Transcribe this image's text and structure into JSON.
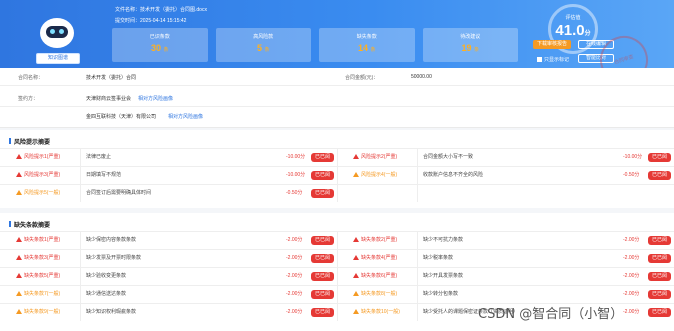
{
  "header": {
    "file_label": "文件名称：技术开发（委托）合同图.docx",
    "time_label": "提交时间：2025-04-14 15:15:42",
    "kb_button": "知识图谱",
    "cards": [
      {
        "label": "已识条款",
        "value": "30",
        "unit": "条"
      },
      {
        "label": "高风险款",
        "value": "5",
        "unit": "条"
      },
      {
        "label": "缺失条款",
        "value": "14",
        "unit": "条"
      },
      {
        "label": "待改建议",
        "value": "19",
        "unit": "条"
      }
    ],
    "gauge": {
      "label": "评估值",
      "value": "41.0",
      "unit": "分"
    },
    "buttons": {
      "download": "下载审核报告",
      "online_edit": "在线编辑",
      "back": "智能比对"
    },
    "checkbox_label": "只显示标记",
    "stamp_text": "合同审查"
  },
  "info": {
    "contract_name_key": "合同名称：",
    "contract_name_val": "技术开发（委托）合同",
    "amount_key": "合同金额(元)：",
    "amount_val": "50000.00",
    "party_key": "签约方：",
    "party1": "天津财商云签事业会",
    "party1_link": "相对方风险画像",
    "party2": "金四互联科技（天津）有限公司",
    "party2_link": "相对方风险画像"
  },
  "risk_section": {
    "title": "风险提示摘要",
    "rows": [
      [
        {
          "level": "风险提示1(严重)",
          "sev": "hi",
          "desc": "法律已废止",
          "score": "-10.00分",
          "btn": "已已阅"
        },
        {
          "level": "风险提示2(严重)",
          "sev": "hi",
          "desc": "合同金额大小写不一致",
          "score": "-10.00分",
          "btn": "已已阅"
        }
      ],
      [
        {
          "level": "风险提示3(严重)",
          "sev": "hi",
          "desc": "日期填写不规范",
          "score": "-10.00分",
          "btn": "已已阅"
        },
        {
          "level": "风险提示4(一般)",
          "sev": "md",
          "desc": "收款账户信息不齐全的风险",
          "score": "-0.50分",
          "btn": "已已阅"
        }
      ],
      [
        {
          "level": "风险提示5(一般)",
          "sev": "md",
          "desc": "合同签订后需要明确具体时间",
          "score": "-0.50分",
          "btn": "已已阅"
        }
      ]
    ]
  },
  "missing_section": {
    "title": "缺失条款摘要",
    "rows": [
      [
        {
          "level": "缺失条款1(严重)",
          "sev": "hi",
          "desc": "缺少保密内容条款条款",
          "score": "-2.00分",
          "btn": "已已阅"
        },
        {
          "level": "缺失条款2(严重)",
          "sev": "hi",
          "desc": "缺少不可抗力条款",
          "score": "-2.00分",
          "btn": "已已阅"
        }
      ],
      [
        {
          "level": "缺失条款3(严重)",
          "sev": "hi",
          "desc": "缺少发票及开票时限条款",
          "score": "-2.00分",
          "btn": "已已阅"
        },
        {
          "level": "缺失条款4(严重)",
          "sev": "hi",
          "desc": "缺少税率条款",
          "score": "-2.00分",
          "btn": "已已阅"
        }
      ],
      [
        {
          "level": "缺失条款5(严重)",
          "sev": "hi",
          "desc": "缺少验收变更条款",
          "score": "-2.00分",
          "btn": "已已阅"
        },
        {
          "level": "缺失条款6(严重)",
          "sev": "hi",
          "desc": "缺少开具发票条款",
          "score": "-2.00分",
          "btn": "已已阅"
        }
      ],
      [
        {
          "level": "缺失条款7(一般)",
          "sev": "md",
          "desc": "缺少通信送达条款",
          "score": "-2.00分",
          "btn": "已已阅"
        },
        {
          "level": "缺失条款8(一般)",
          "sev": "md",
          "desc": "缺少转分包条款",
          "score": "-2.00分",
          "btn": "已已阅"
        }
      ],
      [
        {
          "level": "缺失条款9(一般)",
          "sev": "md",
          "desc": "缺少知识权利瑕疵条款",
          "score": "-2.00分",
          "btn": "已已阅"
        },
        {
          "level": "缺失条款10(一般)",
          "sev": "md",
          "desc": "缺少受托人的课题保密证条款（资质证明）",
          "score": "-2.00分",
          "btn": "已已阅"
        }
      ]
    ]
  },
  "watermark": "CSDN @智合同（小智）"
}
